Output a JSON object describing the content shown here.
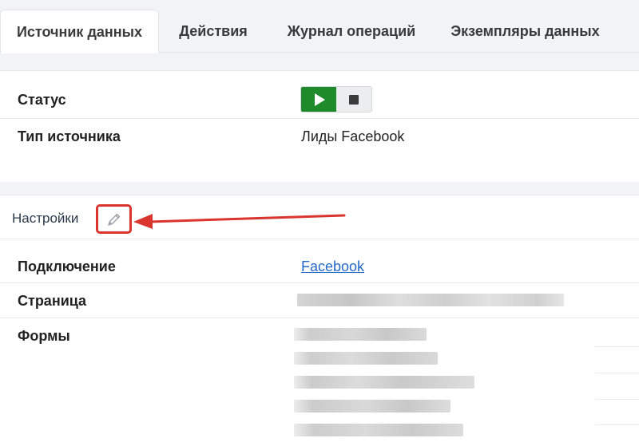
{
  "tabs": [
    {
      "label": "Источник данных",
      "active": true
    },
    {
      "label": "Действия",
      "active": false
    },
    {
      "label": "Журнал операций",
      "active": false
    },
    {
      "label": "Экземпляры данных",
      "active": false
    }
  ],
  "general": {
    "status_label": "Статус",
    "source_type_label": "Тип источника",
    "source_type_value": "Лиды Facebook"
  },
  "settings": {
    "title": "Настройки",
    "connection_label": "Подключение",
    "connection_value": "Facebook",
    "page_label": "Страница",
    "forms_label": "Формы"
  },
  "colors": {
    "play": "#1e8a2a",
    "highlight": "#d9342e",
    "link": "#2569c9"
  },
  "icons": {
    "play": "play-icon",
    "stop": "stop-icon",
    "edit": "pencil-icon",
    "annotation": "arrow-icon"
  }
}
